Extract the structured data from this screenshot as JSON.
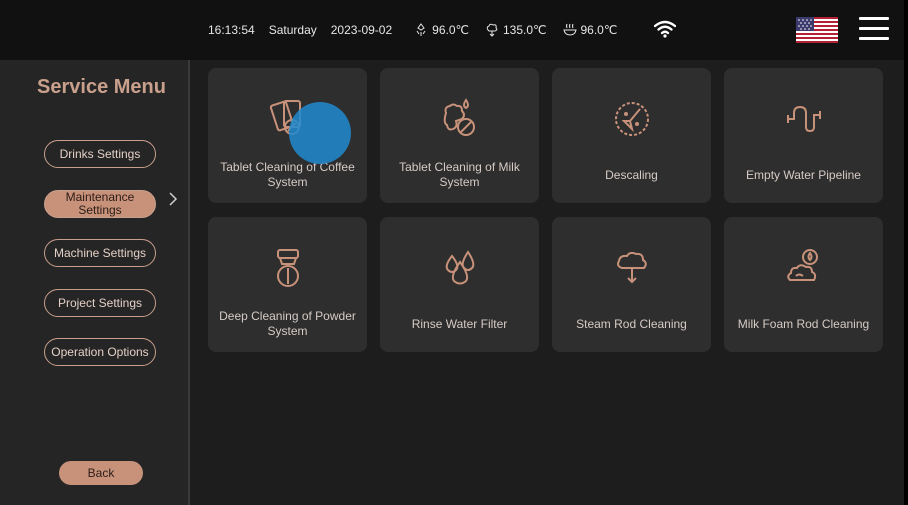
{
  "status": {
    "time": "16:13:54",
    "day": "Saturday",
    "date": "2023-09-02",
    "temps": [
      "96.0℃",
      "135.0℃",
      "96.0℃"
    ]
  },
  "sidebar": {
    "title": "Service Menu",
    "items": [
      "Drinks Settings",
      "Maintenance Settings",
      "Machine Settings",
      "Project Settings",
      "Operation Options"
    ],
    "back": "Back"
  },
  "tiles": [
    {
      "label": "Tablet Cleaning of Coffee System",
      "icon": "coffee-tablet-cleaning-icon"
    },
    {
      "label": "Tablet Cleaning of Milk System",
      "icon": "milk-tablet-cleaning-icon"
    },
    {
      "label": "Descaling",
      "icon": "descaling-icon"
    },
    {
      "label": "Empty Water Pipeline",
      "icon": "water-pipeline-icon"
    },
    {
      "label": "Deep Cleaning of Powder System",
      "icon": "powder-system-icon"
    },
    {
      "label": "Rinse Water Filter",
      "icon": "water-filter-icon"
    },
    {
      "label": "Steam Rod Cleaning",
      "icon": "steam-rod-icon"
    },
    {
      "label": "Milk Foam Rod Cleaning",
      "icon": "milk-foam-rod-icon"
    }
  ],
  "colors": {
    "accent": "#c8927a",
    "tile": "#2e2e2e",
    "background": "#1d1d1d",
    "topbar": "#111111",
    "touch_indicator": "#1e8ad0"
  }
}
